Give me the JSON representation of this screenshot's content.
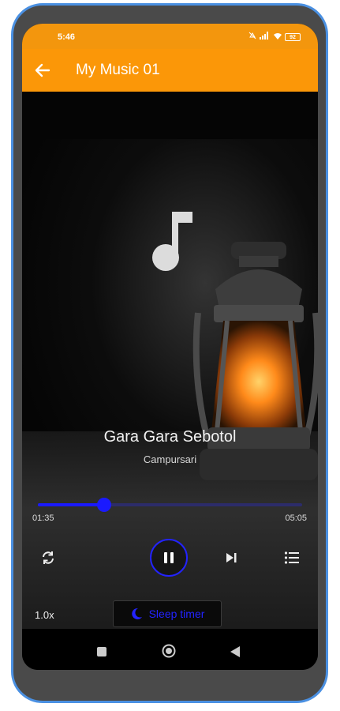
{
  "status_bar": {
    "time": "5:46",
    "battery": "92"
  },
  "app_bar": {
    "title": "My Music 01",
    "back_icon": "arrow-left-icon",
    "color": "#fb9708"
  },
  "player": {
    "song_title": "Gara Gara Sebotol",
    "artist": "Campursari",
    "current_time": "01:35",
    "total_time": "05:05",
    "progress": 0.25,
    "accent": "#1a1aff",
    "controls": {
      "repeat_icon": "repeat-icon",
      "play_pause_icon": "pause-icon",
      "next_icon": "skip-next-icon",
      "playlist_icon": "playlist-icon"
    },
    "speed": "1.0x",
    "sleep_timer_label": "Sleep timer",
    "sleep_timer_icon": "moon-icon"
  },
  "nav_bar": {
    "recents_icon": "square-icon",
    "home_icon": "circle-icon",
    "back_icon": "triangle-back-icon"
  }
}
